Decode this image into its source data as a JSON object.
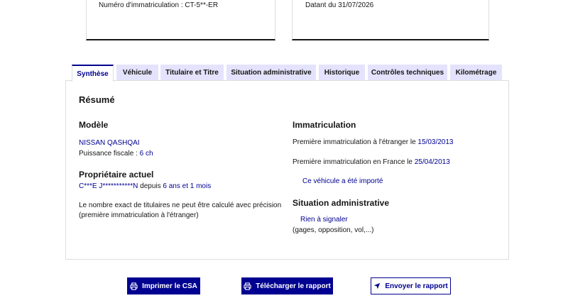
{
  "cards": {
    "left_text": "Numéro d'immatriculation : CT-5**-ER",
    "right_text": "Datant du 31/07/2026"
  },
  "tabs": [
    {
      "label": "Synthèse",
      "active": true
    },
    {
      "label": "Véhicule",
      "active": false
    },
    {
      "label": "Titulaire et Titre",
      "active": false
    },
    {
      "label": "Situation administrative",
      "active": false
    },
    {
      "label": "Historique",
      "active": false
    },
    {
      "label": "Contrôles techniques",
      "active": false
    },
    {
      "label": "Kilométrage",
      "active": false
    }
  ],
  "summary": {
    "title": "Résumé",
    "model": {
      "heading": "Modèle",
      "name": "NISSAN QASHQAI",
      "fiscal_label": "Puissance fiscale : ",
      "fiscal_value": "6 ch"
    },
    "owner": {
      "heading": "Propriétaire actuel",
      "name": "C***E J***********N",
      "since_label": " depuis ",
      "since_value": "6 ans et 1 mois",
      "note_line1": "Le nombre exact de titulaires ne peut être calculé avec précision",
      "note_line2": "(première immatriculation à l'étranger)"
    },
    "registration": {
      "heading": "Immatriculation",
      "foreign_label": "Première immatriculation à l'étranger le ",
      "foreign_date": "15/03/2013",
      "france_label": "Première immatriculation en France le ",
      "france_date": "25/04/2013",
      "imported_link": "Ce véhicule a été importé"
    },
    "admin": {
      "heading": "Situation administrative",
      "status_link": "Rien à signaler",
      "status_detail": "(gages, opposition, vol,...)"
    }
  },
  "actions": {
    "print": "Imprimer le CSA",
    "download": "Télécharger le rapport",
    "send": "Envoyer le rapport"
  },
  "colors": {
    "primary": "#000091",
    "tab_inactive": "#e3e3fd",
    "border": "#dddddd"
  }
}
